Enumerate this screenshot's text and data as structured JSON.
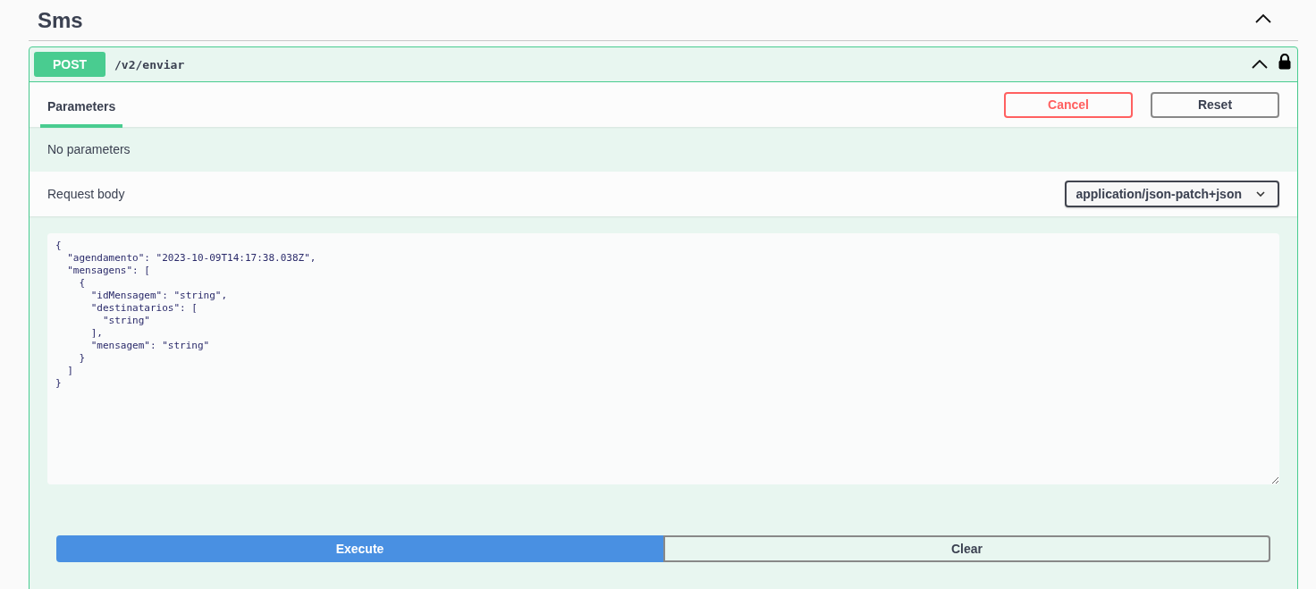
{
  "section": {
    "title": "Sms",
    "expanded": true
  },
  "operation": {
    "method": "POST",
    "path": "/v2/enviar",
    "expanded": true,
    "locked": true
  },
  "tabs": [
    {
      "label": "Parameters",
      "selected": true
    }
  ],
  "header_buttons": [
    {
      "label": "Cancel",
      "kind": "cancel"
    },
    {
      "label": "Reset",
      "kind": "reset"
    }
  ],
  "parameters_message": "No parameters",
  "request_body": {
    "label": "Request body",
    "content_type": "application/json-patch+json",
    "value": "{\n  \"agendamento\": \"2023-10-09T14:17:38.038Z\",\n  \"mensagens\": [\n    {\n      \"idMensagem\": \"string\",\n      \"destinatarios\": [\n        \"string\"\n      ],\n      \"mensagem\": \"string\"\n    }\n  ]\n}"
  },
  "actions": [
    {
      "label": "Execute",
      "kind": "primary"
    },
    {
      "label": "Clear",
      "kind": "secondary"
    }
  ]
}
